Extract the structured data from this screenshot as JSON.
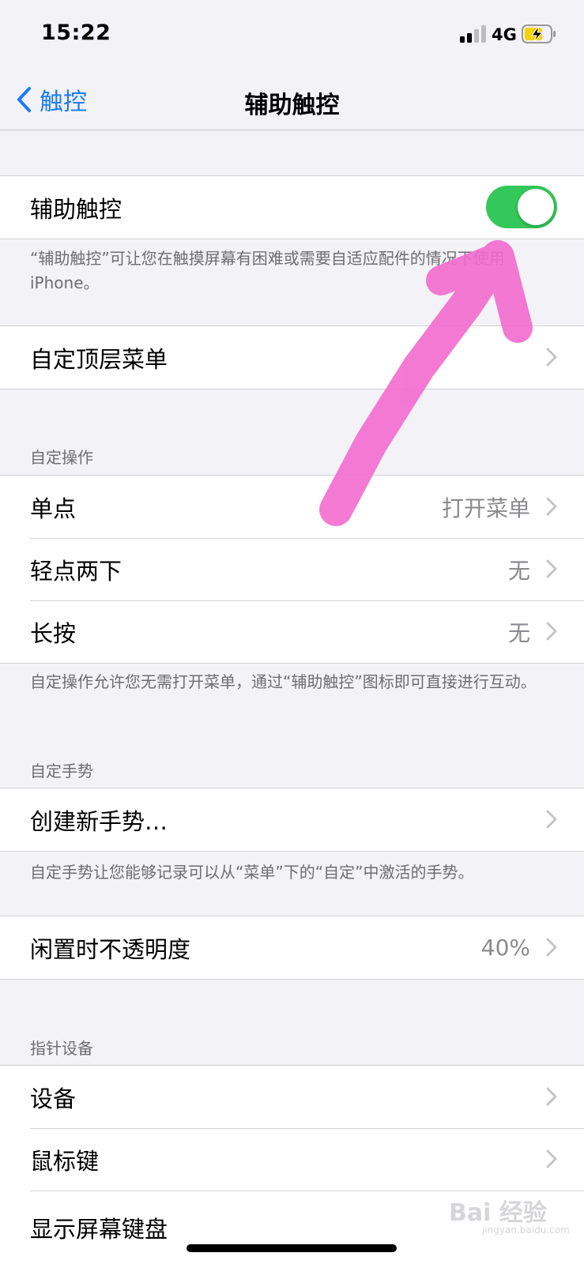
{
  "status_bar": {
    "time": "15:22",
    "network": "4G"
  },
  "nav": {
    "back_label": "触控",
    "title": "辅助触控"
  },
  "toggle_row": {
    "label": "辅助触控",
    "enabled": true,
    "accent": "#34c759"
  },
  "toggle_note": "“辅助触控”可让您在触摸屏幕有困难或需要自适应配件的情况下使用iPhone。",
  "top_menu_row": {
    "label": "自定顶层菜单"
  },
  "custom_actions": {
    "header": "自定操作",
    "rows": [
      {
        "label": "单点",
        "value": "打开菜单"
      },
      {
        "label": "轻点两下",
        "value": "无"
      },
      {
        "label": "长按",
        "value": "无"
      }
    ],
    "note": "自定操作允许您无需打开菜单，通过“辅助触控”图标即可直接进行互动。"
  },
  "custom_gestures": {
    "header": "自定手势",
    "rows": [
      {
        "label": "创建新手势…"
      }
    ],
    "note": "自定手势让您能够记录可以从“菜单”下的“自定”中激活的手势。"
  },
  "idle_opacity_row": {
    "label": "闲置时不透明度",
    "value": "40%"
  },
  "pointer_devices": {
    "header": "指针设备",
    "rows": [
      {
        "label": "设备"
      },
      {
        "label": "鼠标键"
      },
      {
        "label": "显示屏幕键盘"
      }
    ]
  },
  "watermark": {
    "text": "Bai 经验",
    "sub": "jingyan.baidu.com"
  },
  "colors": {
    "accent_blue": "#1a7cf5",
    "annotation_pink": "#f36bcf"
  }
}
